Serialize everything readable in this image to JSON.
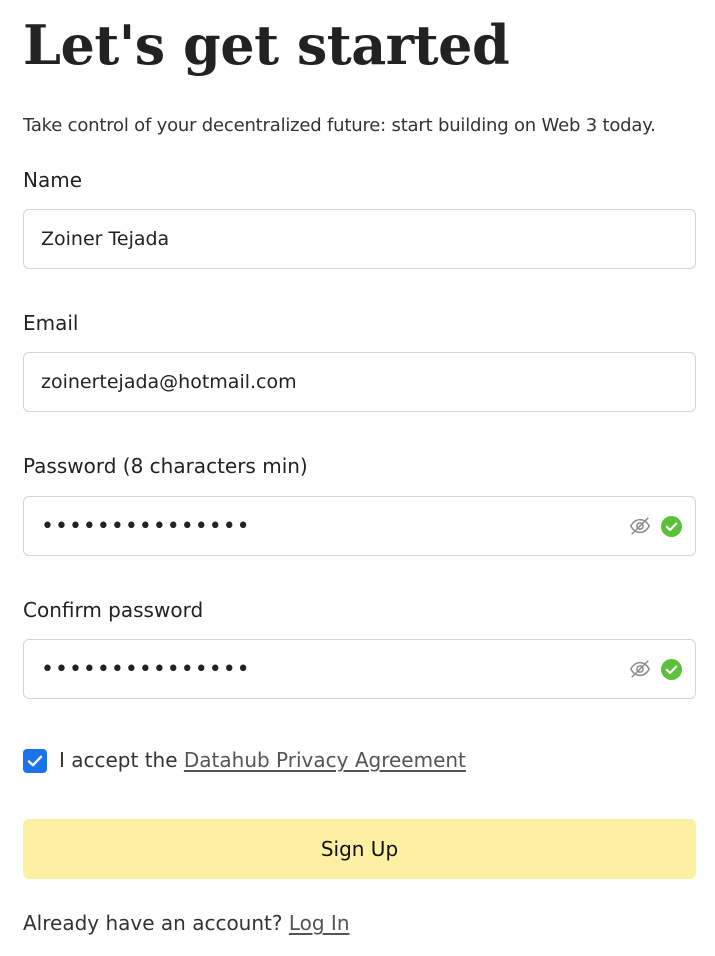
{
  "header": {
    "title": "Let's get started",
    "subtitle": "Take control of your decentralized future: start building on Web 3 today."
  },
  "form": {
    "name": {
      "label": "Name",
      "value": "Zoiner Tejada"
    },
    "email": {
      "label": "Email",
      "value": "zoinertejada@hotmail.com"
    },
    "password": {
      "label": "Password (8 characters min)",
      "value": "•••••••••••••••",
      "visibility_icon": "eye-off-icon",
      "valid_icon": "check-circle-icon"
    },
    "confirm_password": {
      "label": "Confirm password",
      "value": "•••••••••••••••",
      "visibility_icon": "eye-off-icon",
      "valid_icon": "check-circle-icon"
    },
    "accept": {
      "checked": true,
      "prefix": "I accept the",
      "link_text": "Datahub Privacy Agreement"
    },
    "submit_label": "Sign Up"
  },
  "footer": {
    "prompt": "Already have an account?",
    "login_link": "Log In"
  },
  "colors": {
    "button_bg": "#fdf0a2",
    "checkbox": "#1a73e8",
    "valid_check": "#5cc13a",
    "input_border": "#d5d5d5"
  }
}
